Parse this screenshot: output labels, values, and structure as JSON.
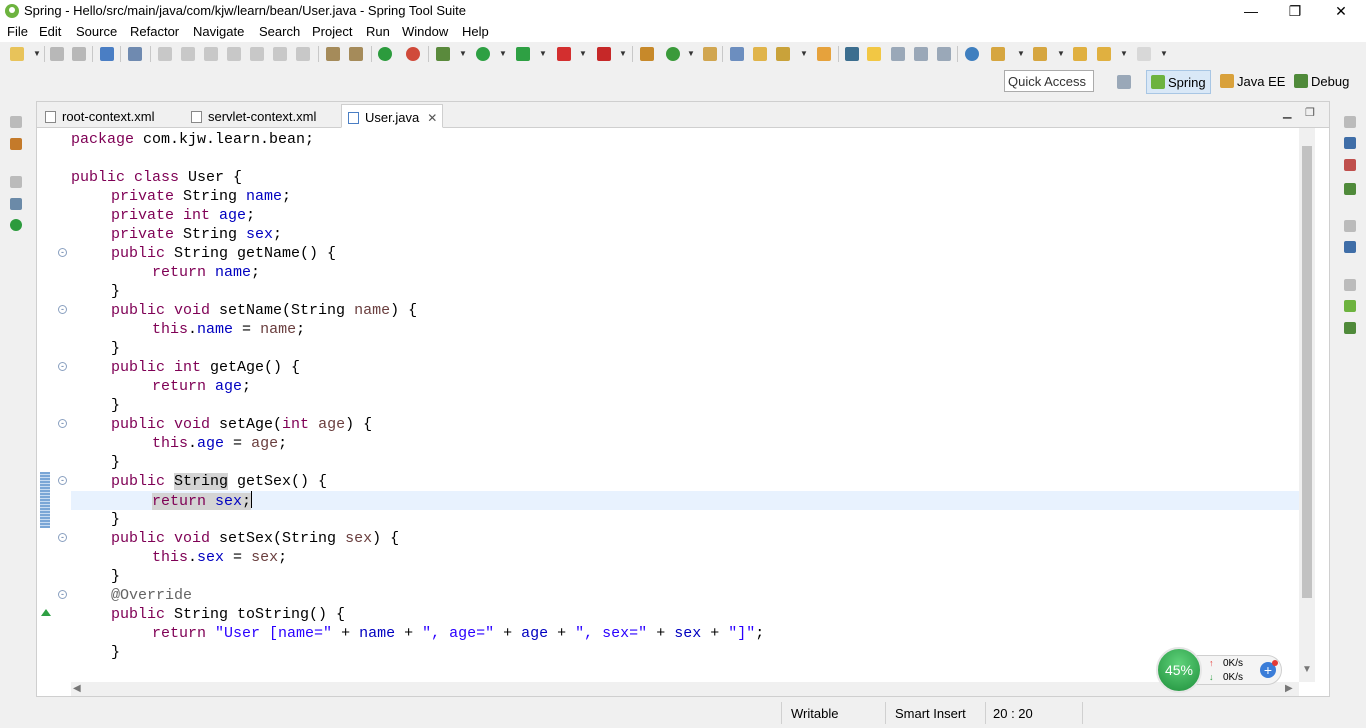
{
  "window": {
    "title": "Spring - Hello/src/main/java/com/kjw/learn/bean/User.java - Spring Tool Suite",
    "minimize_glyph": "—",
    "restore_glyph": "❐",
    "close_glyph": "✕"
  },
  "menu": [
    {
      "label": "File"
    },
    {
      "label": "Edit"
    },
    {
      "label": "Source"
    },
    {
      "label": "Refactor"
    },
    {
      "label": "Navigate"
    },
    {
      "label": "Search"
    },
    {
      "label": "Project"
    },
    {
      "label": "Run"
    },
    {
      "label": "Window"
    },
    {
      "label": "Help"
    }
  ],
  "toolbar": {
    "icons": [
      "new-icon",
      "save-icon",
      "save-all-icon",
      "print-icon",
      "terminal-icon",
      "debug-icon",
      "resume-icon",
      "suspend-icon",
      "stop-icon",
      "disconnect-icon",
      "step-into-icon",
      "step-over-icon",
      "step-return-icon",
      "drop-frame-icon",
      "use-step-filters-icon",
      "power-icon",
      "spring-boot-icon",
      "bug-icon",
      "run-icon",
      "coverage-icon",
      "stop-server-icon",
      "external-tools-icon",
      "new-package-icon",
      "refresh-icon",
      "new-class-icon",
      "open-type-icon",
      "open-folder-icon",
      "search-icon",
      "task-icon",
      "toggle-mark-icon",
      "highlight-icon",
      "block-select-icon",
      "whitespace-icon",
      "web-icon",
      "globe-icon",
      "next-annotation-icon",
      "prev-annotation-icon",
      "back-icon",
      "forward-icon"
    ]
  },
  "quick_access": {
    "placeholder": "Quick Access"
  },
  "perspectives": [
    {
      "label": "Spring",
      "active": true
    },
    {
      "label": "Java EE",
      "active": false
    },
    {
      "label": "Debug",
      "active": false
    }
  ],
  "tabs": [
    {
      "label": "root-context.xml",
      "active": false
    },
    {
      "label": "servlet-context.xml",
      "active": false
    },
    {
      "label": "User.java",
      "active": true,
      "close": "✕"
    }
  ],
  "code": {
    "l0": {
      "kw": "package",
      "rest": " com.kjw.learn.bean;"
    },
    "l1": {
      "kw": "public class",
      "rest": " User {"
    },
    "l2": {
      "kw": "private",
      "type": " String ",
      "fld": "name",
      "end": ";"
    },
    "l3": {
      "kw": "private int",
      "sp": " ",
      "fld": "age",
      "end": ";"
    },
    "l4": {
      "kw": "private",
      "type": " String ",
      "fld": "sex",
      "end": ";"
    },
    "l5": {
      "kw": "public",
      "rest": " String getName() {"
    },
    "l6": {
      "kw": "return",
      "sp": " ",
      "fld": "name",
      "end": ";"
    },
    "l7": {
      "rest": "}"
    },
    "l8": {
      "kw": "public void",
      "a": " setName(String ",
      "prm": "name",
      "b": ") {"
    },
    "l9": {
      "kw": "this",
      "dot": ".",
      "fld": "name",
      "eq": " = ",
      "prm": "name",
      "end": ";"
    },
    "l10": {
      "rest": "}"
    },
    "l11": {
      "kw": "public int",
      "rest": " getAge() {"
    },
    "l12": {
      "kw": "return",
      "sp": " ",
      "fld": "age",
      "end": ";"
    },
    "l13": {
      "rest": "}"
    },
    "l14": {
      "kw": "public void",
      "a": " setAge(",
      "kw2": "int",
      "sp": " ",
      "prm": "age",
      "b": ") {"
    },
    "l15": {
      "kw": "this",
      "dot": ".",
      "fld": "age",
      "eq": " = ",
      "prm": "age",
      "end": ";"
    },
    "l16": {
      "rest": "}"
    },
    "l17": {
      "kw": "public",
      "sp": " ",
      "hl": "String",
      "rest": " getSex() {"
    },
    "l18": {
      "kw": "return",
      "sp": " ",
      "fld": "sex",
      "end": ";"
    },
    "l19": {
      "rest": "}"
    },
    "l20": {
      "kw": "public void",
      "a": " setSex(String ",
      "prm": "sex",
      "b": ") {"
    },
    "l21": {
      "kw": "this",
      "dot": ".",
      "fld": "sex",
      "eq": " = ",
      "prm": "sex",
      "end": ";"
    },
    "l22": {
      "rest": "}"
    },
    "l23": {
      "ann": "@Override"
    },
    "l24": {
      "kw": "public",
      "rest": " String toString() {"
    },
    "l25": {
      "kw": "return",
      "s1": "\"User [name=\"",
      "p1": " + ",
      "f1": "name",
      "p2": " + ",
      "s2": "\", age=\"",
      "p3": " + ",
      "f2": "age",
      "p4": " + ",
      "s3": "\", sex=\"",
      "p5": " + ",
      "f3": "sex",
      "p6": " + ",
      "s4": "\"]\"",
      "end": ";"
    },
    "l26": {
      "rest": "}"
    }
  },
  "status": {
    "writable": "Writable",
    "insert_mode": "Smart Insert",
    "position": "20 : 20"
  },
  "net_monitor": {
    "percent": "45%",
    "up_rate": "0K/s",
    "down_rate": "0K/s",
    "up_arrow": "↑",
    "down_arrow": "↓",
    "plus": "+"
  },
  "colors": {
    "keyword": "#7f0055",
    "field": "#0000c0",
    "param": "#6a3e3e",
    "string": "#2a00ff",
    "annotation": "#646464",
    "current_line": "#e8f2fe"
  }
}
